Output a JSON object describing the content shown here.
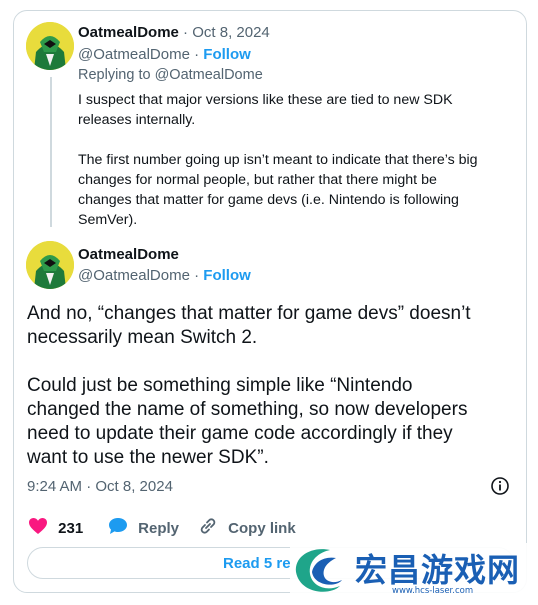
{
  "reply": {
    "author_name": "OatmealDome",
    "separator": "·",
    "date": "Oct 8, 2024",
    "handle": "@OatmealDome",
    "follow_label": "Follow",
    "replying_to": "Replying to @OatmealDome",
    "text": "I suspect that major versions like these are tied to new SDK\nreleases internally.\n\nThe first number going up isn’t meant to indicate that there’s big\nchanges for normal people, but rather that there might be\nchanges that matter for game devs (i.e. Nintendo is following\nSemVer)."
  },
  "main": {
    "author_name": "OatmealDome",
    "handle": "@OatmealDome",
    "follow_label": "Follow",
    "text": "And no, “changes that matter for game devs” doesn’t\nnecessarily mean Switch 2.\n\nCould just be something simple like “Nintendo\nchanged the name of something, so now developers\nneed to update their game code accordingly if they\nwant to use the newer SDK”.",
    "timestamp": "9:24 AM · Oct 8, 2024"
  },
  "actions": {
    "likes": "231",
    "reply_label": "Reply",
    "copy_label": "Copy link"
  },
  "read_button": {
    "label": "Read 5 re"
  },
  "watermark": {
    "text": "宏昌游戏网",
    "url": "www.hcs-laser.com"
  },
  "colors": {
    "accent": "#1d9bf0",
    "like": "#f91880",
    "muted": "#536471",
    "watermark": "#1a5fb4"
  }
}
